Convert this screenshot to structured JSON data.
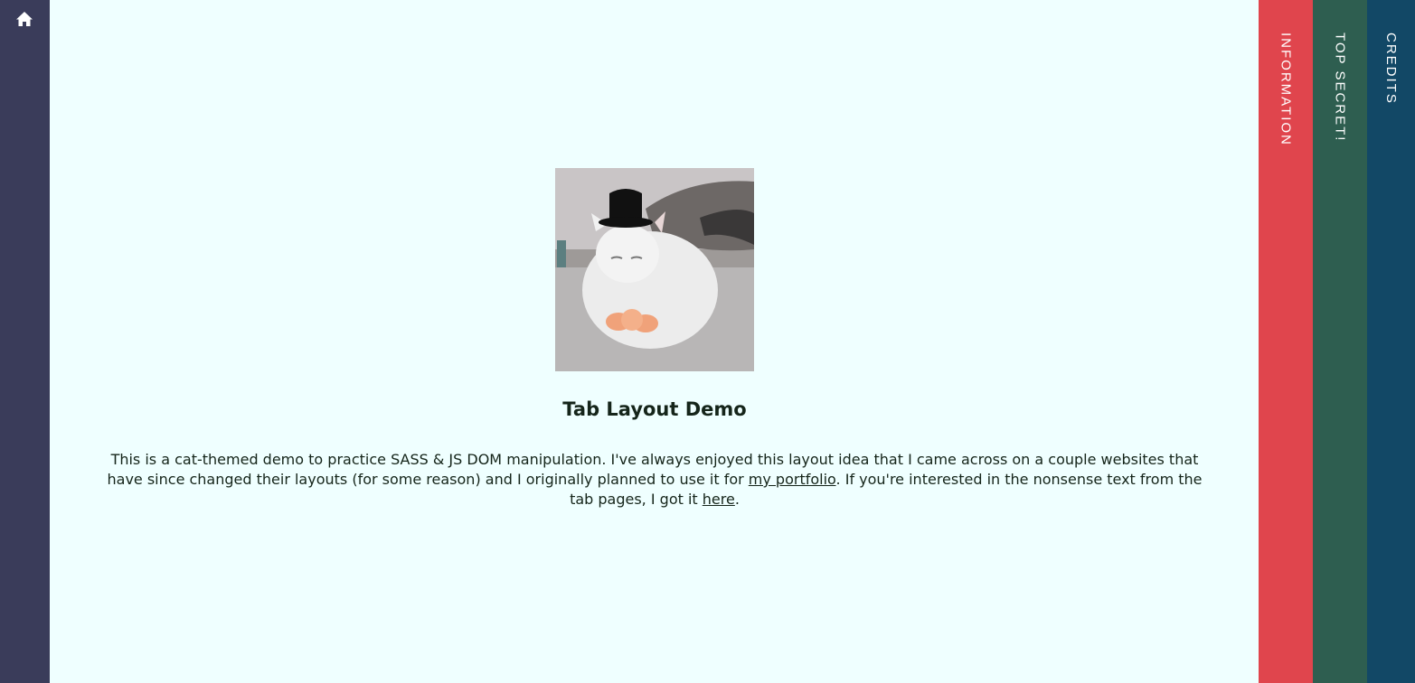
{
  "nav": {
    "home_icon": "home-icon"
  },
  "tabs": [
    {
      "label": "INFORMATION",
      "color": "#e0454d"
    },
    {
      "label": "TOP SECRET!",
      "color": "#2e5e50"
    },
    {
      "label": "CREDITS",
      "color": "#124866"
    }
  ],
  "main": {
    "image_alt": "cat wearing top hat",
    "title": "Tab Layout Demo",
    "description": {
      "part1": "This is a cat-themed demo to practice SASS & JS DOM manipulation. I've always enjoyed this layout idea that I came across on a couple websites that have since changed their layouts (for some reason) and I originally planned to use it for ",
      "link1": "my portfolio",
      "part2": ". If you're interested in the nonsense text from the tab pages, I got it ",
      "link2": "here",
      "part3": "."
    }
  },
  "colors": {
    "background": "#efffff",
    "home_bar": "#3a3c5a"
  }
}
